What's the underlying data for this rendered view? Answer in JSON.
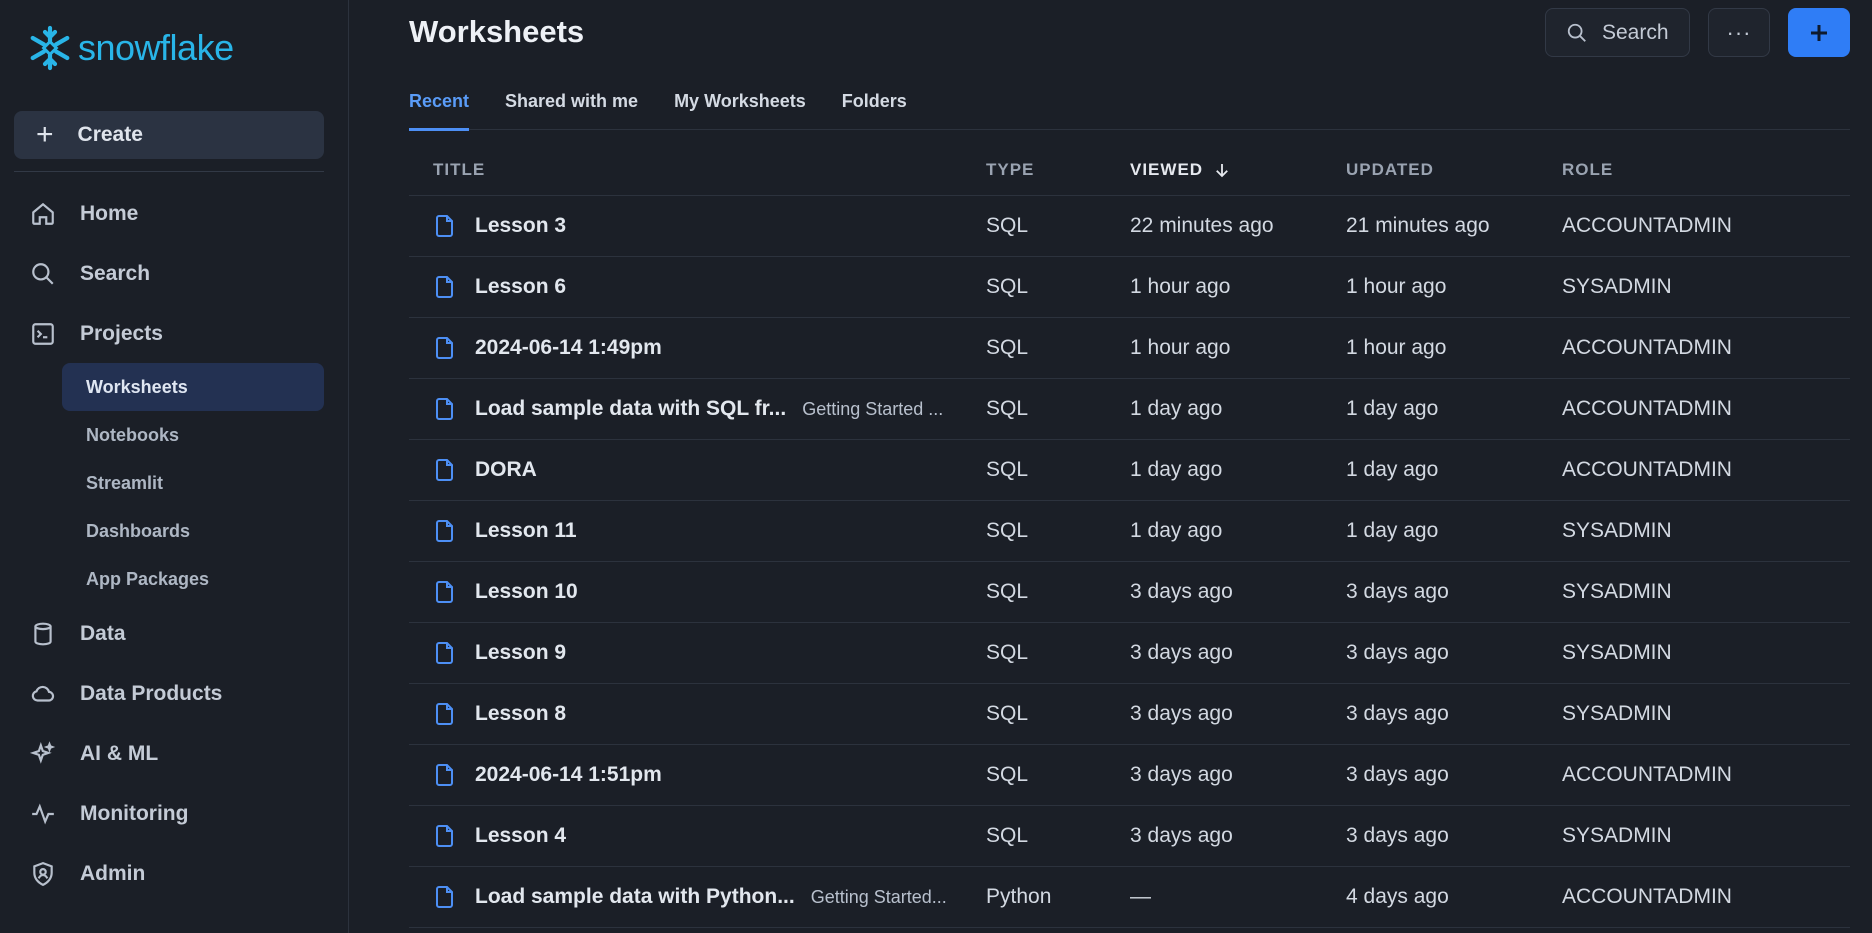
{
  "brand": {
    "name": "snowflake",
    "color": "#29b5e8"
  },
  "sidebar": {
    "create_label": "Create",
    "items": [
      {
        "label": "Home",
        "icon": "home-icon"
      },
      {
        "label": "Search",
        "icon": "search-icon"
      },
      {
        "label": "Projects",
        "icon": "terminal-icon"
      },
      {
        "label": "Data",
        "icon": "database-icon"
      },
      {
        "label": "Data Products",
        "icon": "cloud-icon"
      },
      {
        "label": "AI & ML",
        "icon": "sparkle-icon"
      },
      {
        "label": "Monitoring",
        "icon": "activity-icon"
      },
      {
        "label": "Admin",
        "icon": "shield-user-icon"
      }
    ],
    "projects_sub": [
      "Worksheets",
      "Notebooks",
      "Streamlit",
      "Dashboards",
      "App Packages"
    ],
    "active_sub": "Worksheets"
  },
  "header": {
    "title": "Worksheets",
    "search_label": "Search",
    "more_label": "···",
    "accent_color": "#2f7df6"
  },
  "tabs": [
    "Recent",
    "Shared with me",
    "My Worksheets",
    "Folders"
  ],
  "active_tab": "Recent",
  "table": {
    "columns": [
      "TITLE",
      "TYPE",
      "VIEWED",
      "UPDATED",
      "ROLE"
    ],
    "sorted_by": "VIEWED",
    "rows": [
      {
        "title": "Lesson 3",
        "folder": "",
        "type": "SQL",
        "viewed": "22 minutes ago",
        "updated": "21 minutes ago",
        "role": "ACCOUNTADMIN"
      },
      {
        "title": "Lesson 6",
        "folder": "",
        "type": "SQL",
        "viewed": "1 hour ago",
        "updated": "1 hour ago",
        "role": "SYSADMIN"
      },
      {
        "title": "2024-06-14 1:49pm",
        "folder": "",
        "type": "SQL",
        "viewed": "1 hour ago",
        "updated": "1 hour ago",
        "role": "ACCOUNTADMIN"
      },
      {
        "title": "Load sample data with SQL fr...",
        "folder": "Getting Started ...",
        "type": "SQL",
        "viewed": "1 day ago",
        "updated": "1 day ago",
        "role": "ACCOUNTADMIN"
      },
      {
        "title": "DORA",
        "folder": "",
        "type": "SQL",
        "viewed": "1 day ago",
        "updated": "1 day ago",
        "role": "ACCOUNTADMIN"
      },
      {
        "title": "Lesson 11",
        "folder": "",
        "type": "SQL",
        "viewed": "1 day ago",
        "updated": "1 day ago",
        "role": "SYSADMIN"
      },
      {
        "title": "Lesson 10",
        "folder": "",
        "type": "SQL",
        "viewed": "3 days ago",
        "updated": "3 days ago",
        "role": "SYSADMIN"
      },
      {
        "title": "Lesson 9",
        "folder": "",
        "type": "SQL",
        "viewed": "3 days ago",
        "updated": "3 days ago",
        "role": "SYSADMIN"
      },
      {
        "title": "Lesson 8",
        "folder": "",
        "type": "SQL",
        "viewed": "3 days ago",
        "updated": "3 days ago",
        "role": "SYSADMIN"
      },
      {
        "title": "2024-06-14 1:51pm",
        "folder": "",
        "type": "SQL",
        "viewed": "3 days ago",
        "updated": "3 days ago",
        "role": "ACCOUNTADMIN"
      },
      {
        "title": "Lesson 4",
        "folder": "",
        "type": "SQL",
        "viewed": "3 days ago",
        "updated": "3 days ago",
        "role": "SYSADMIN"
      },
      {
        "title": "Load sample data with Python...",
        "folder": "Getting Started...",
        "type": "Python",
        "viewed": "—",
        "updated": "4 days ago",
        "role": "ACCOUNTADMIN"
      }
    ]
  }
}
